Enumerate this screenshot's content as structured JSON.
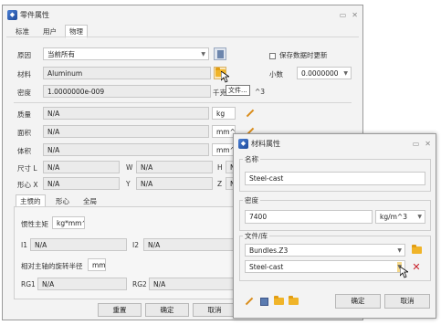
{
  "main_window": {
    "title": "零件属性",
    "tabs": [
      "标准",
      "用户",
      "物理"
    ],
    "source": {
      "label": "原因",
      "value": "当前所有"
    },
    "save_checkbox_label": "保存数据时更新",
    "material": {
      "label": "材料",
      "value": "Aluminum"
    },
    "decimals": {
      "label": "小数",
      "value": "0.0000000"
    },
    "density": {
      "label": "密度",
      "value": "1.0000000e-009",
      "unit": "千克",
      "unit_suffix": "^3"
    },
    "tooltip": "文件...",
    "mass": {
      "label": "质量",
      "value": "N/A",
      "unit": "kg"
    },
    "area": {
      "label": "面积",
      "value": "N/A",
      "unit": "mm^2"
    },
    "volume": {
      "label": "体积",
      "value": "N/A",
      "unit": "mm^"
    },
    "size": {
      "label": "尺寸 L",
      "l": "N/A",
      "w_label": "W",
      "w": "N/A",
      "h_label": "H",
      "h": "N"
    },
    "centroid": {
      "label": "形心 X",
      "x": "N/A",
      "y_label": "Y",
      "y": "N/A",
      "z_label": "Z",
      "z": "N"
    },
    "sub_tabs": [
      "主惯的",
      "形心",
      "全局"
    ],
    "inertia_label": "惯性主矩",
    "inertia_unit": "kg*mm^",
    "i1": {
      "label": "I1",
      "value": "N/A"
    },
    "i2": {
      "label": "I2",
      "value": "N/A"
    },
    "gyration_label": "相对主轴的旋转半径",
    "gyration_unit": "mm",
    "rg1": {
      "label": "RG1",
      "value": "N/A"
    },
    "rg2": {
      "label": "RG2",
      "value": "N/A"
    },
    "buttons": {
      "reset": "重置",
      "ok": "确定",
      "cancel": "取消"
    }
  },
  "material_dialog": {
    "title": "材料属性",
    "name_group": "名称",
    "name_value": "Steel-cast",
    "density_group": "密度",
    "density_value": "7400",
    "density_unit": "kg/m^3",
    "file_group": "文件/库",
    "file_value": "Bundles.Z3",
    "library_value": "Steel-cast",
    "buttons": {
      "ok": "确定",
      "cancel": "取消"
    }
  }
}
